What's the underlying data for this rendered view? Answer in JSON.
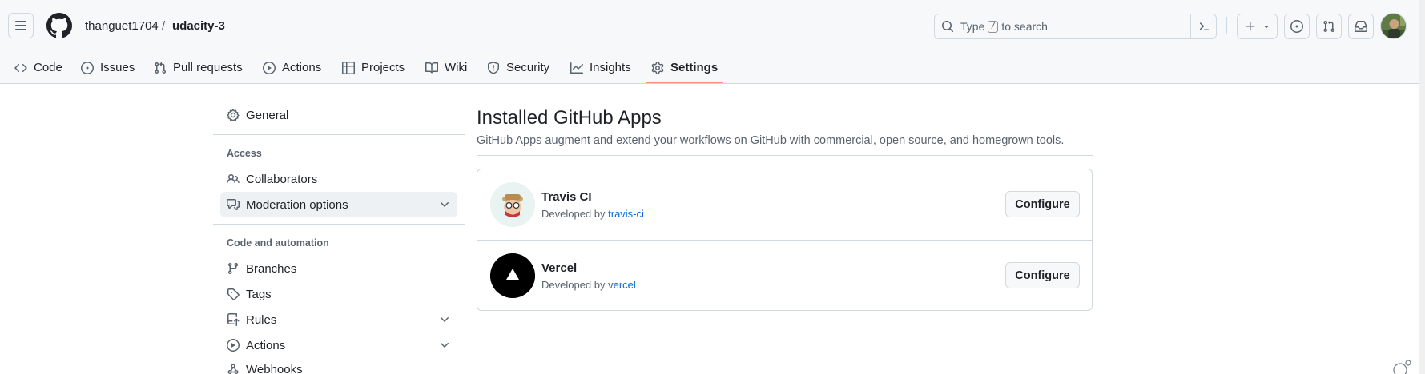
{
  "header": {
    "owner": "thanguet1704",
    "separator": "/",
    "repo": "udacity-3",
    "search_prefix": "Type",
    "search_key": "/",
    "search_suffix": "to search"
  },
  "tabs": [
    {
      "label": "Code",
      "icon": "code-icon"
    },
    {
      "label": "Issues",
      "icon": "issue-opened-icon"
    },
    {
      "label": "Pull requests",
      "icon": "git-pull-request-icon"
    },
    {
      "label": "Actions",
      "icon": "play-icon"
    },
    {
      "label": "Projects",
      "icon": "table-icon"
    },
    {
      "label": "Wiki",
      "icon": "book-icon"
    },
    {
      "label": "Security",
      "icon": "shield-icon"
    },
    {
      "label": "Insights",
      "icon": "graph-icon"
    },
    {
      "label": "Settings",
      "icon": "gear-icon",
      "active": true
    }
  ],
  "sidebar": {
    "general": "General",
    "access_heading": "Access",
    "collaborators": "Collaborators",
    "moderation": "Moderation options",
    "code_heading": "Code and automation",
    "branches": "Branches",
    "tags": "Tags",
    "rules": "Rules",
    "actions": "Actions",
    "webhooks": "Webhooks"
  },
  "main": {
    "title": "Installed GitHub Apps",
    "description": "GitHub Apps augment and extend your workflows on GitHub with commercial, open source, and homegrown tools.",
    "apps": [
      {
        "name": "Travis CI",
        "dev_prefix": "Developed by",
        "developer": "travis-ci",
        "button": "Configure"
      },
      {
        "name": "Vercel",
        "dev_prefix": "Developed by",
        "developer": "vercel",
        "button": "Configure"
      }
    ]
  },
  "colors": {
    "accent_underline": "#fd8c73",
    "link": "#0969da",
    "muted": "#59636e"
  }
}
